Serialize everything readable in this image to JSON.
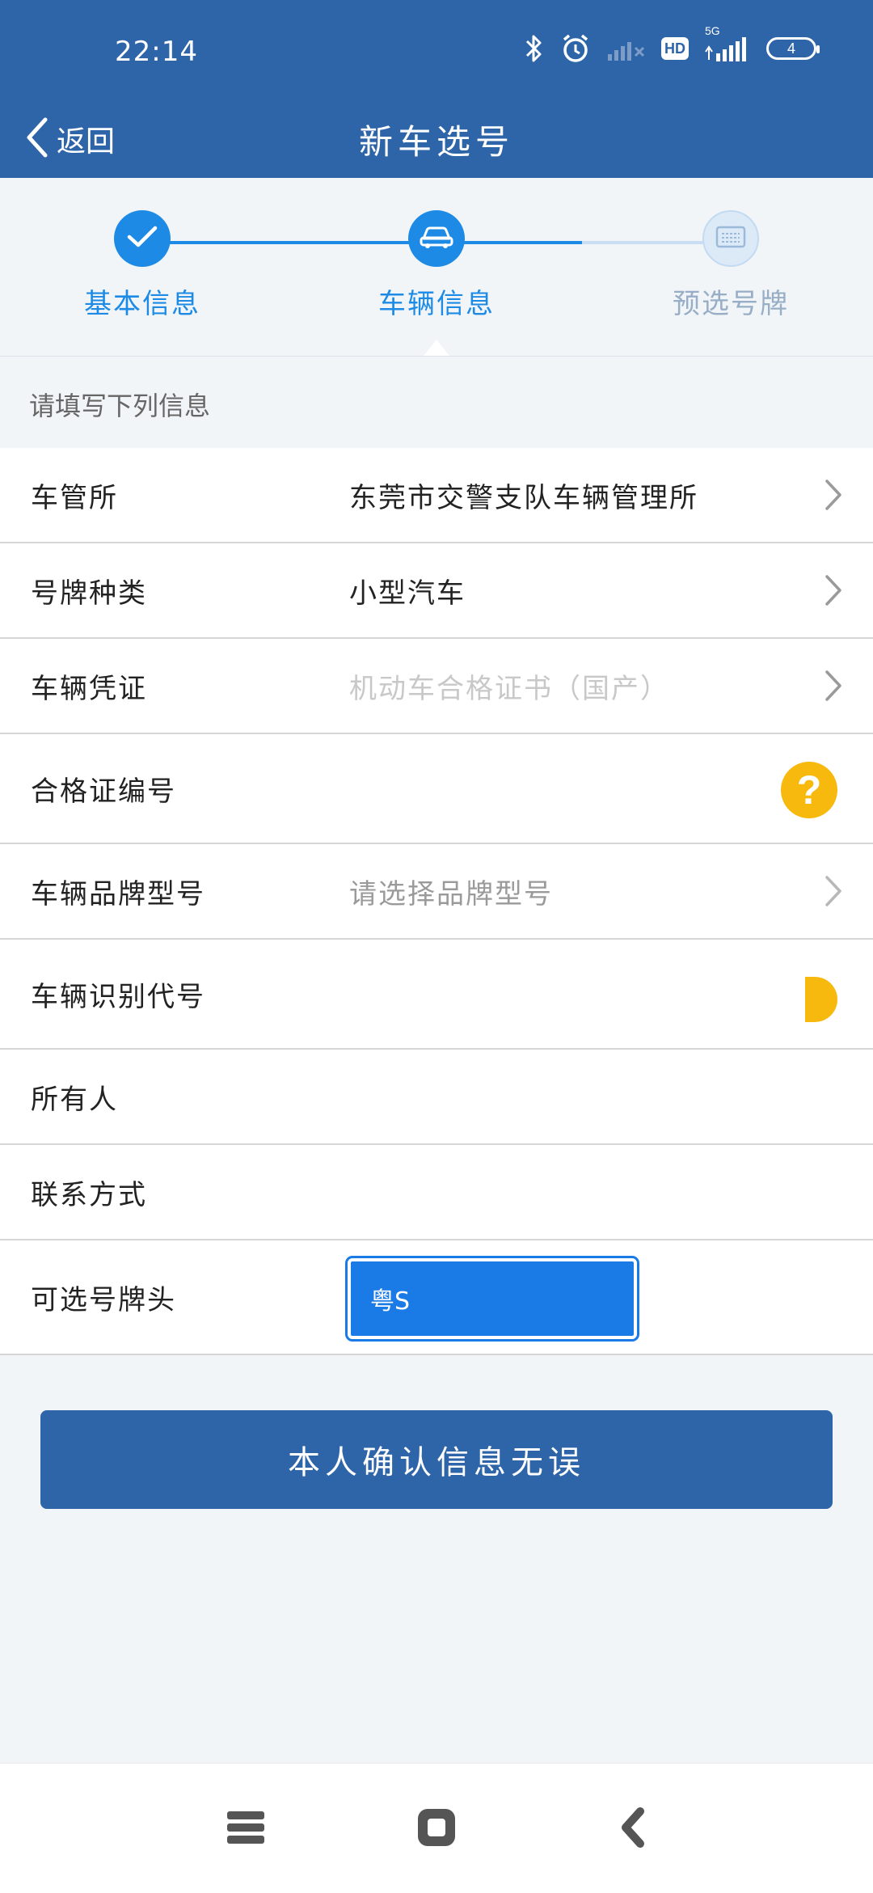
{
  "status_bar": {
    "time": "22:14",
    "icons": [
      "bluetooth-icon",
      "alarm-icon",
      "signal-weak-icon",
      "hd-icon",
      "signal-5g-icon",
      "battery-icon"
    ],
    "hd_label": "HD",
    "network_label": "5G",
    "battery_level": "4"
  },
  "nav": {
    "back_label": "返回",
    "title": "新车选号"
  },
  "stepper": {
    "steps": [
      {
        "label": "基本信息",
        "state": "done",
        "icon": "check-icon"
      },
      {
        "label": "车辆信息",
        "state": "current",
        "icon": "car-icon"
      },
      {
        "label": "预选号牌",
        "state": "pending",
        "icon": "plate-icon"
      }
    ],
    "active_color": "#1d8be6",
    "pending_color": "#c9def2"
  },
  "section_hint": "请填写下列信息",
  "form": {
    "rows": [
      {
        "label": "车管所",
        "value": "东莞市交警支队车辆管理所"
      },
      {
        "label": "号牌种类",
        "value": "小型汽车"
      },
      {
        "label": "车辆凭证",
        "value": "机动车合格证书（国产）"
      },
      {
        "label": "合格证编号",
        "value": ""
      },
      {
        "label": "车辆品牌型号",
        "value": "",
        "placeholder": "请选择品牌型号"
      },
      {
        "label": "车辆识别代号",
        "value": ""
      },
      {
        "label": "所有人",
        "value": ""
      },
      {
        "label": "联系方式",
        "value": ""
      },
      {
        "label": "可选号牌头",
        "value": "粤S"
      }
    ]
  },
  "help_icon_glyph": "?",
  "confirm_button": "本人确认信息无误",
  "colors": {
    "header": "#2e64a8",
    "accent": "#1d8be6",
    "help": "#f8b90e",
    "plate": "#1a7ae6"
  }
}
